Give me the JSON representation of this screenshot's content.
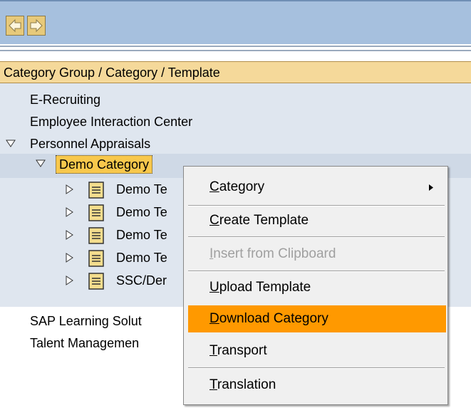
{
  "header": {
    "title": "Category Group / Category / Template"
  },
  "tree": {
    "items": [
      {
        "label": "E-Recruiting"
      },
      {
        "label": "Employee Interaction Center"
      },
      {
        "label": "Personnel Appraisals"
      }
    ],
    "selected": {
      "label": "Demo Category"
    },
    "children": [
      {
        "label": "Demo Te"
      },
      {
        "label": "Demo Te"
      },
      {
        "label": "Demo Te"
      },
      {
        "label": "Demo Te"
      },
      {
        "label": "SSC/Der"
      }
    ],
    "bottom_items": [
      {
        "label": "SAP Learning Solut"
      },
      {
        "label": "Talent Managemen"
      }
    ]
  },
  "context_menu": {
    "items": [
      {
        "label": "Category",
        "underline": "C",
        "rest": "ategory"
      },
      {
        "label": "Create Template",
        "underline": "C",
        "rest": "reate Template"
      },
      {
        "label": "Insert from Clipboard",
        "underline": "I",
        "rest": "nsert from Clipboard"
      },
      {
        "label": "Upload Template",
        "underline": "U",
        "rest": "pload Template"
      },
      {
        "label": "Download Category",
        "underline": "D",
        "rest": "ownload Category"
      },
      {
        "label": "Transport",
        "underline": "T",
        "rest": "ransport"
      },
      {
        "label": "Translation",
        "underline": "T",
        "rest": "ranslation"
      }
    ]
  },
  "colors": {
    "toolbar": "#a6c0de",
    "header": "#f5d99a",
    "tree_bg": "#dfe6ef",
    "selected": "#f8c84c",
    "menu_highlight": "#ff9900"
  }
}
